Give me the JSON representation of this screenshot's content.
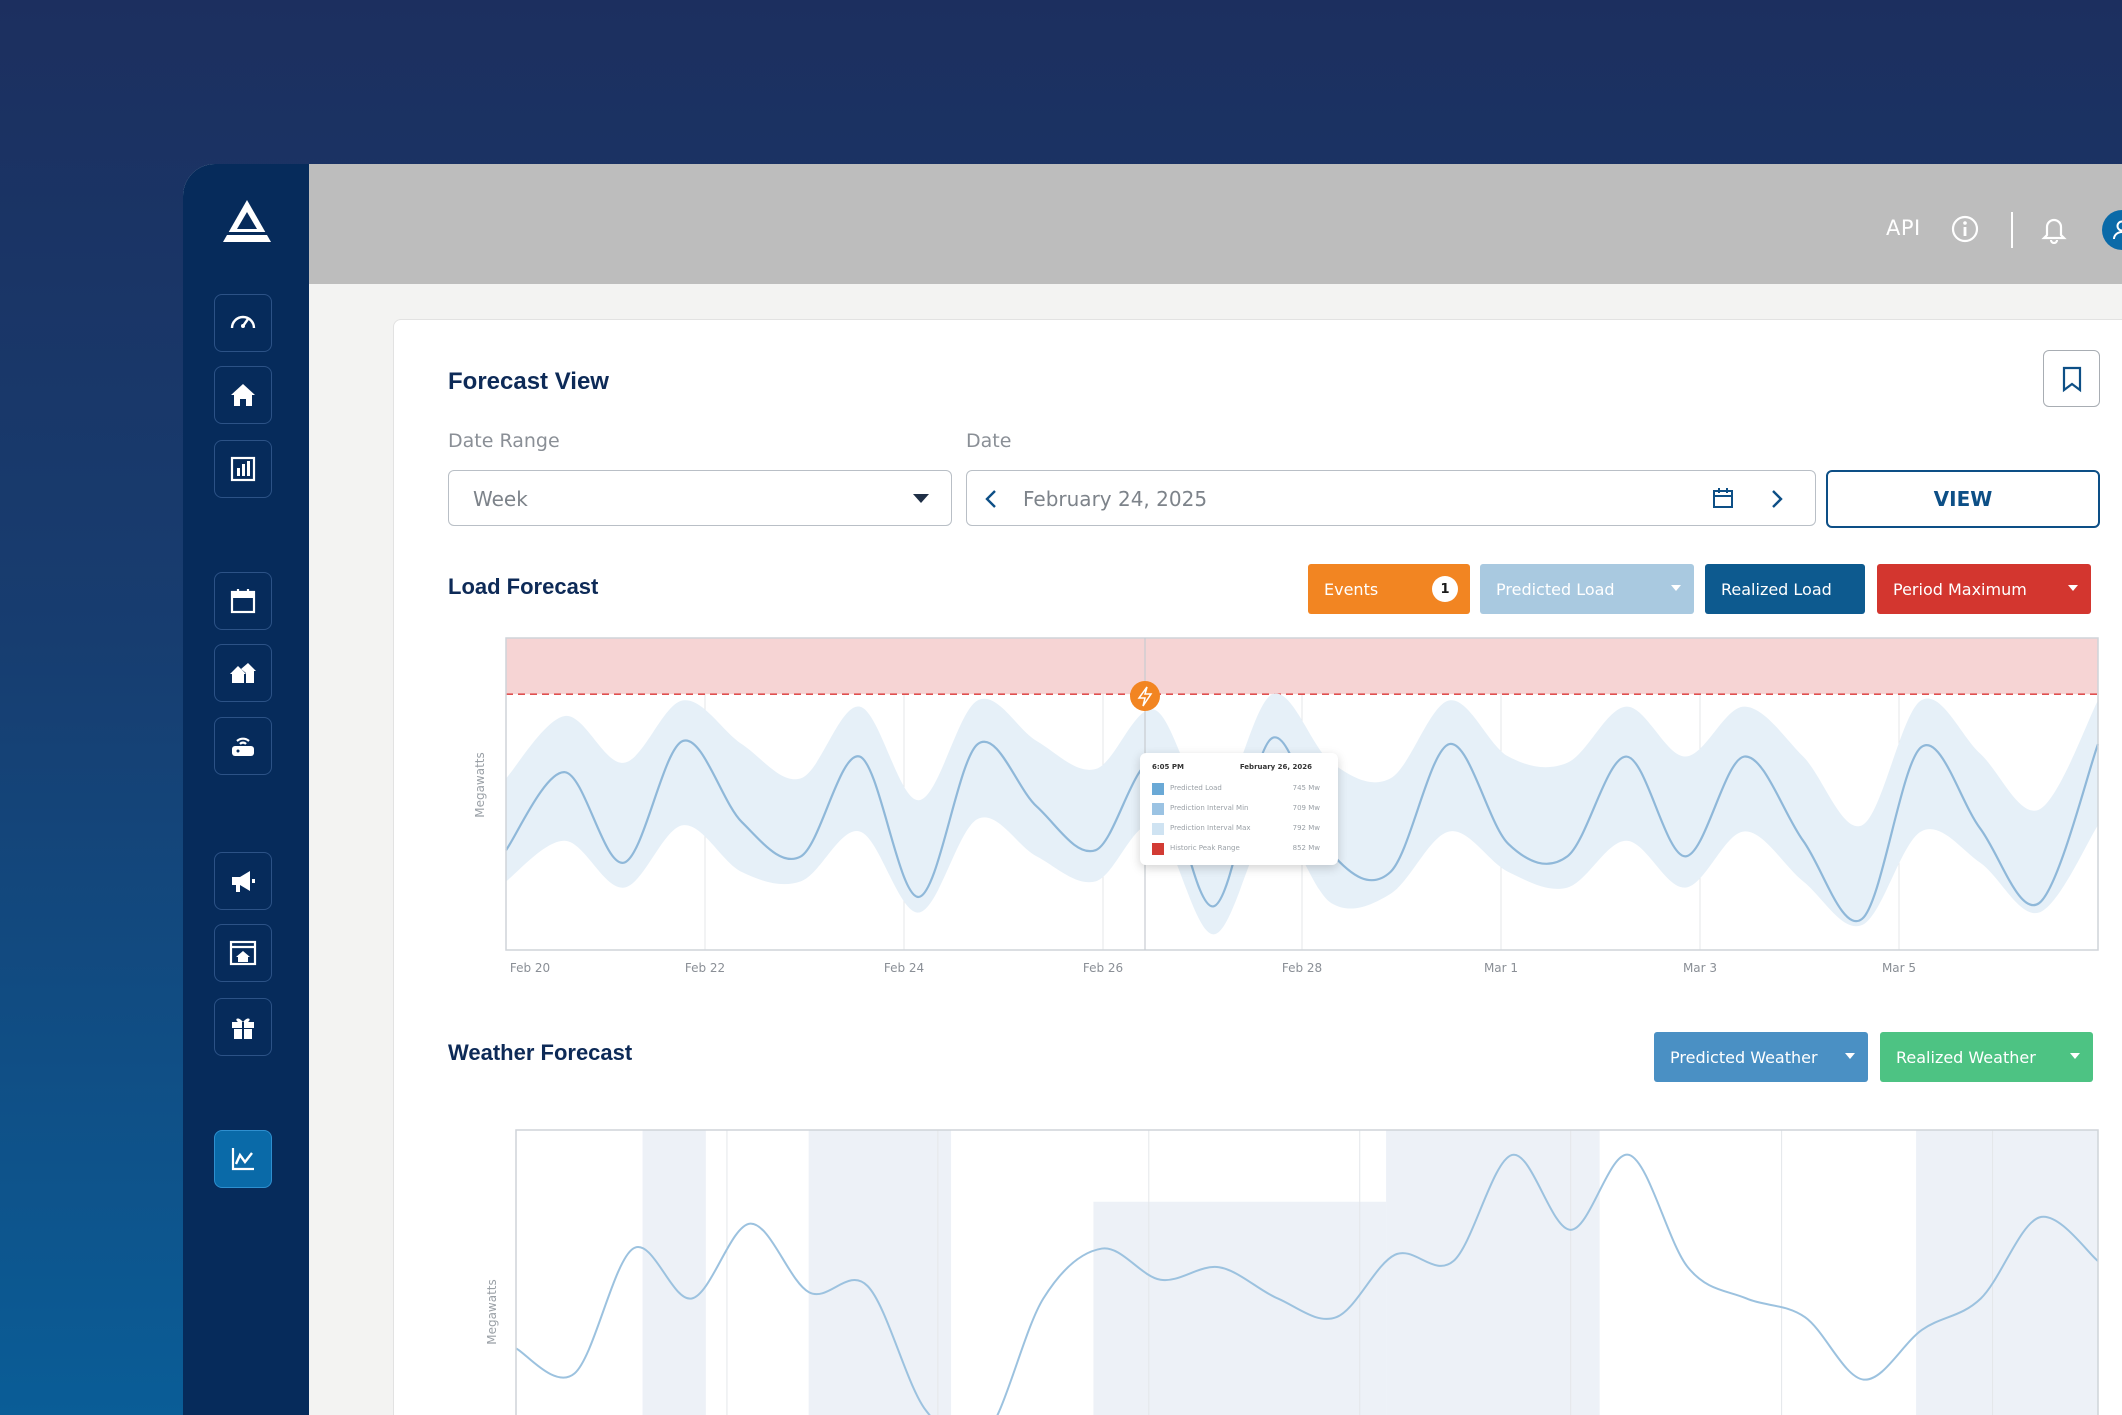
{
  "topbar": {
    "api_label": "API"
  },
  "forecast_view": {
    "title": "Forecast View",
    "date_range_label": "Date Range",
    "date_range_value": "Week",
    "date_label": "Date",
    "date_value": "February 24, 2025",
    "view_button": "VIEW"
  },
  "load_forecast": {
    "title": "Load Forecast",
    "legend": {
      "events_label": "Events",
      "events_count": "1",
      "predicted_label": "Predicted Load",
      "realized_label": "Realized Load",
      "maximum_label": "Period Maximum"
    },
    "tooltip": {
      "time": "6:05 PM",
      "date": "February 26, 2026",
      "rows": [
        {
          "label": "Predicted Load",
          "value": "745 Mw",
          "color": "#6aa9d6"
        },
        {
          "label": "Prediction Interval Min",
          "value": "709 Mw",
          "color": "#9bc3e3"
        },
        {
          "label": "Prediction Interval Max",
          "value": "792 Mw",
          "color": "#cfe3f2"
        },
        {
          "label": "Historic Peak Range",
          "value": "852 Mw",
          "color": "#d23b34"
        }
      ]
    }
  },
  "weather_forecast": {
    "title": "Weather Forecast",
    "legend": {
      "predicted_label": "Predicted Weather",
      "realized_label": "Realized Weather"
    }
  },
  "colors": {
    "navy": "#062b5b",
    "events": "#f28522",
    "predicted_load": "#a9c9e0",
    "realized_load": "#0d5a8f",
    "period_maximum": "#d3362f",
    "predicted_weather": "#4a90c4",
    "realized_weather": "#4dc383"
  },
  "chart_data": [
    {
      "type": "line",
      "title": "Load Forecast",
      "ylabel": "Megawatts",
      "x": [
        "Feb 20",
        "Feb 20.5",
        "Feb 21",
        "Feb 21.5",
        "Feb 22",
        "Feb 22.5",
        "Feb 23",
        "Feb 23.5",
        "Feb 24",
        "Feb 24.5",
        "Feb 25",
        "Feb 25.5",
        "Feb 26",
        "Feb 26.5",
        "Feb 27",
        "Feb 27.5",
        "Feb 28",
        "Feb 28.5",
        "Mar 1",
        "Mar 1.5",
        "Mar 2",
        "Mar 2.5",
        "Mar 3",
        "Mar 3.5",
        "Mar 4",
        "Mar 4.5",
        "Mar 5",
        "Mar 5.5"
      ],
      "x_ticks": [
        "Feb 20",
        "Feb 22",
        "Feb 24",
        "Feb 26",
        "Feb 28",
        "Mar 1",
        "Mar 3",
        "Mar 5"
      ],
      "series": [
        {
          "name": "Realized Load",
          "values": [
            0.32,
            0.57,
            0.28,
            0.67,
            0.41,
            0.3,
            0.62,
            0.17,
            0.66,
            0.46,
            0.32,
            0.6,
            0.14,
            0.68,
            0.31,
            0.25,
            0.66,
            0.34,
            0.3,
            0.62,
            0.3,
            0.62,
            0.35,
            0.1,
            0.65,
            0.39,
            0.15,
            0.66
          ]
        },
        {
          "name": "Prediction Interval Max",
          "values": [
            0.55,
            0.75,
            0.6,
            0.8,
            0.66,
            0.55,
            0.78,
            0.48,
            0.8,
            0.67,
            0.58,
            0.77,
            0.45,
            0.82,
            0.6,
            0.55,
            0.8,
            0.62,
            0.6,
            0.78,
            0.62,
            0.78,
            0.62,
            0.4,
            0.8,
            0.63,
            0.45,
            0.8
          ]
        },
        {
          "name": "Prediction Interval Min",
          "values": [
            0.22,
            0.35,
            0.2,
            0.4,
            0.25,
            0.22,
            0.38,
            0.12,
            0.42,
            0.3,
            0.22,
            0.4,
            0.05,
            0.4,
            0.15,
            0.18,
            0.38,
            0.25,
            0.2,
            0.35,
            0.2,
            0.38,
            0.22,
            0.08,
            0.38,
            0.28,
            0.12,
            0.4
          ]
        }
      ],
      "period_maximum": 0.82,
      "ylim": [
        0,
        1
      ]
    },
    {
      "type": "line",
      "title": "Weather Forecast",
      "ylabel": "Megawatts",
      "x": [
        "Feb 20",
        "Feb 20.5",
        "Feb 21",
        "Feb 21.5",
        "Feb 22",
        "Feb 22.5",
        "Feb 23",
        "Feb 23.5",
        "Feb 24",
        "Feb 24.5",
        "Feb 25",
        "Feb 25.5",
        "Feb 26",
        "Feb 26.5",
        "Feb 27",
        "Feb 27.5",
        "Feb 28",
        "Feb 28.5",
        "Mar 1",
        "Mar 1.5",
        "Mar 2",
        "Mar 2.5",
        "Mar 3",
        "Mar 3.5",
        "Mar 4",
        "Mar 4.5",
        "Mar 5",
        "Mar 5.5"
      ],
      "series": [
        {
          "name": "Realized Weather",
          "values": [
            0.3,
            0.22,
            0.62,
            0.46,
            0.7,
            0.48,
            0.5,
            0.1,
            0.02,
            0.46,
            0.62,
            0.52,
            0.56,
            0.46,
            0.4,
            0.6,
            0.58,
            0.92,
            0.68,
            0.92,
            0.56,
            0.46,
            0.4,
            0.2,
            0.36,
            0.46,
            0.72,
            0.58
          ]
        }
      ],
      "ylim": [
        0,
        1
      ]
    }
  ]
}
